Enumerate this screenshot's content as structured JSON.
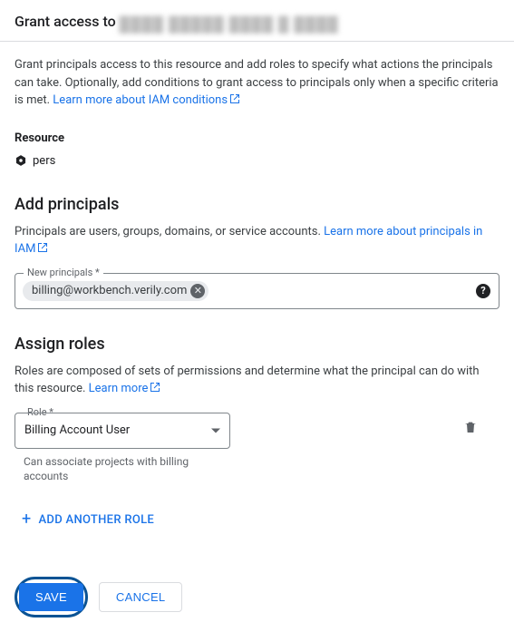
{
  "header": {
    "prefix": "Grant access to",
    "redacted": "████ █████ ████ █ ████"
  },
  "intro": {
    "text": "Grant principals access to this resource and add roles to specify what actions the principals can take. Optionally, add conditions to grant access to principals only when a specific criteria is met. ",
    "link": "Learn more about IAM conditions"
  },
  "resource": {
    "label": "Resource",
    "name": "pers"
  },
  "principals": {
    "heading": "Add principals",
    "desc": "Principals are users, groups, domains, or service accounts. ",
    "desc_link": "Learn more about principals in IAM",
    "field_label": "New principals *",
    "chip": "billing@workbench.verily.com"
  },
  "roles": {
    "heading": "Assign roles",
    "desc": "Roles are composed of sets of permissions and determine what the principal can do with this resource. ",
    "desc_link": "Learn more",
    "role_label": "Role *",
    "selected": "Billing Account User",
    "helper": "Can associate projects with billing accounts",
    "add_another": "ADD ANOTHER ROLE"
  },
  "actions": {
    "save": "SAVE",
    "cancel": "CANCEL"
  }
}
